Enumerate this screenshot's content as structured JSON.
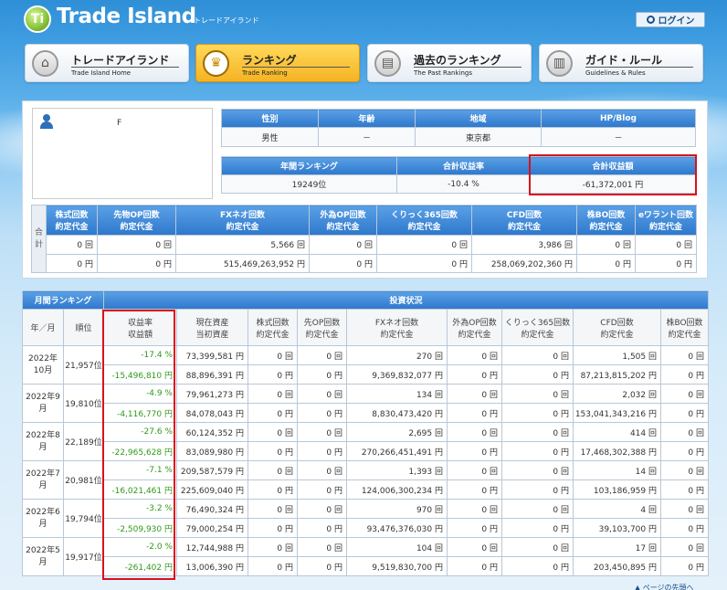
{
  "brand": {
    "logo_letter": "Ti",
    "name": "Trade Island",
    "sub": "トレードアイランド"
  },
  "login": {
    "label": "ログイン"
  },
  "nav": [
    {
      "title": "トレードアイランド",
      "sub": "Trade Island Home",
      "icon": "home-icon",
      "glyph": "⌂"
    },
    {
      "title": "ランキング",
      "sub": "Trade Ranking",
      "icon": "crown-icon",
      "glyph": "♛"
    },
    {
      "title": "過去のランキング",
      "sub": "The Past Rankings",
      "icon": "archive-icon",
      "glyph": "▤"
    },
    {
      "title": "ガイド・ルール",
      "sub": "Guidelines & Rules",
      "icon": "book-icon",
      "glyph": "▥"
    }
  ],
  "profile": {
    "name": "F"
  },
  "info": {
    "headers": [
      "性別",
      "年齢",
      "地域",
      "HP/Blog"
    ],
    "values": [
      "男性",
      "－",
      "東京都",
      "－"
    ]
  },
  "summary": {
    "headers": [
      "年間ランキング",
      "合計収益率",
      "合計収益額"
    ],
    "values": [
      "19249位",
      "-10.4 %",
      "-61,372,001 円"
    ]
  },
  "totals": {
    "side": "合計",
    "headers": [
      [
        "株式回数",
        "約定代金"
      ],
      [
        "先物OP回数",
        "約定代金"
      ],
      [
        "FXネオ回数",
        "約定代金"
      ],
      [
        "外為OP回数",
        "約定代金"
      ],
      [
        "くりっく365回数",
        "約定代金"
      ],
      [
        "CFD回数",
        "約定代金"
      ],
      [
        "株BO回数",
        "約定代金"
      ],
      [
        "eワラント回数",
        "約定代金"
      ]
    ],
    "counts": [
      "0 回",
      "0 回",
      "5,566 回",
      "0 回",
      "0 回",
      "3,986 回",
      "0 回",
      "0 回"
    ],
    "amounts": [
      "0 円",
      "0 円",
      "515,469,263,952 円",
      "0 円",
      "0 円",
      "258,069,202,360 円",
      "0 円",
      "0 円"
    ]
  },
  "monthly": {
    "group_left": "月間ランキング",
    "group_right": "投資状況",
    "headers": [
      "年／月",
      "順位",
      [
        "収益率",
        "収益額"
      ],
      [
        "現在資産",
        "当初資産"
      ],
      [
        "株式回数",
        "約定代金"
      ],
      [
        "先OP回数",
        "約定代金"
      ],
      [
        "FXネオ回数",
        "約定代金"
      ],
      [
        "外為OP回数",
        "約定代金"
      ],
      [
        "くりっく365回数",
        "約定代金"
      ],
      [
        "CFD回数",
        "約定代金"
      ],
      [
        "株BO回数",
        "約定代金"
      ]
    ],
    "rows": [
      {
        "ym": "2022年10月",
        "rank": "21,957位",
        "r1": [
          "-17.4 %",
          "73,399,581 円",
          "0 回",
          "0 回",
          "270 回",
          "0 回",
          "0 回",
          "1,505 回",
          "0 回"
        ],
        "r2": [
          "-15,496,810 円",
          "88,896,391 円",
          "0 円",
          "0 円",
          "9,369,832,077 円",
          "0 円",
          "0 円",
          "87,213,815,202 円",
          "0 円"
        ]
      },
      {
        "ym": "2022年9月",
        "rank": "19,810位",
        "r1": [
          "-4.9 %",
          "79,961,273 円",
          "0 回",
          "0 回",
          "134 回",
          "0 回",
          "0 回",
          "2,032 回",
          "0 回"
        ],
        "r2": [
          "-4,116,770 円",
          "84,078,043 円",
          "0 円",
          "0 円",
          "8,830,473,420 円",
          "0 円",
          "0 円",
          "153,041,343,216 円",
          "0 円"
        ]
      },
      {
        "ym": "2022年8月",
        "rank": "22,189位",
        "r1": [
          "-27.6 %",
          "60,124,352 円",
          "0 回",
          "0 回",
          "2,695 回",
          "0 回",
          "0 回",
          "414 回",
          "0 回"
        ],
        "r2": [
          "-22,965,628 円",
          "83,089,980 円",
          "0 円",
          "0 円",
          "270,266,451,491 円",
          "0 円",
          "0 円",
          "17,468,302,388 円",
          "0 円"
        ]
      },
      {
        "ym": "2022年7月",
        "rank": "20,981位",
        "r1": [
          "-7.1 %",
          "209,587,579 円",
          "0 回",
          "0 回",
          "1,393 回",
          "0 回",
          "0 回",
          "14 回",
          "0 回"
        ],
        "r2": [
          "-16,021,461 円",
          "225,609,040 円",
          "0 円",
          "0 円",
          "124,006,300,234 円",
          "0 円",
          "0 円",
          "103,186,959 円",
          "0 円"
        ]
      },
      {
        "ym": "2022年6月",
        "rank": "19,794位",
        "r1": [
          "-3.2 %",
          "76,490,324 円",
          "0 回",
          "0 回",
          "970 回",
          "0 回",
          "0 回",
          "4 回",
          "0 回"
        ],
        "r2": [
          "-2,509,930 円",
          "79,000,254 円",
          "0 円",
          "0 円",
          "93,476,376,030 円",
          "0 円",
          "0 円",
          "39,103,700 円",
          "0 円"
        ]
      },
      {
        "ym": "2022年5月",
        "rank": "19,917位",
        "r1": [
          "-2.0 %",
          "12,744,988 円",
          "0 回",
          "0 回",
          "104 回",
          "0 回",
          "0 回",
          "17 回",
          "0 回"
        ],
        "r2": [
          "-261,402 円",
          "13,006,390 円",
          "0 円",
          "0 円",
          "9,519,830,700 円",
          "0 円",
          "0 円",
          "203,450,895 円",
          "0 円"
        ]
      }
    ]
  },
  "footer": {
    "link": "▲ ページの先頭へ"
  }
}
